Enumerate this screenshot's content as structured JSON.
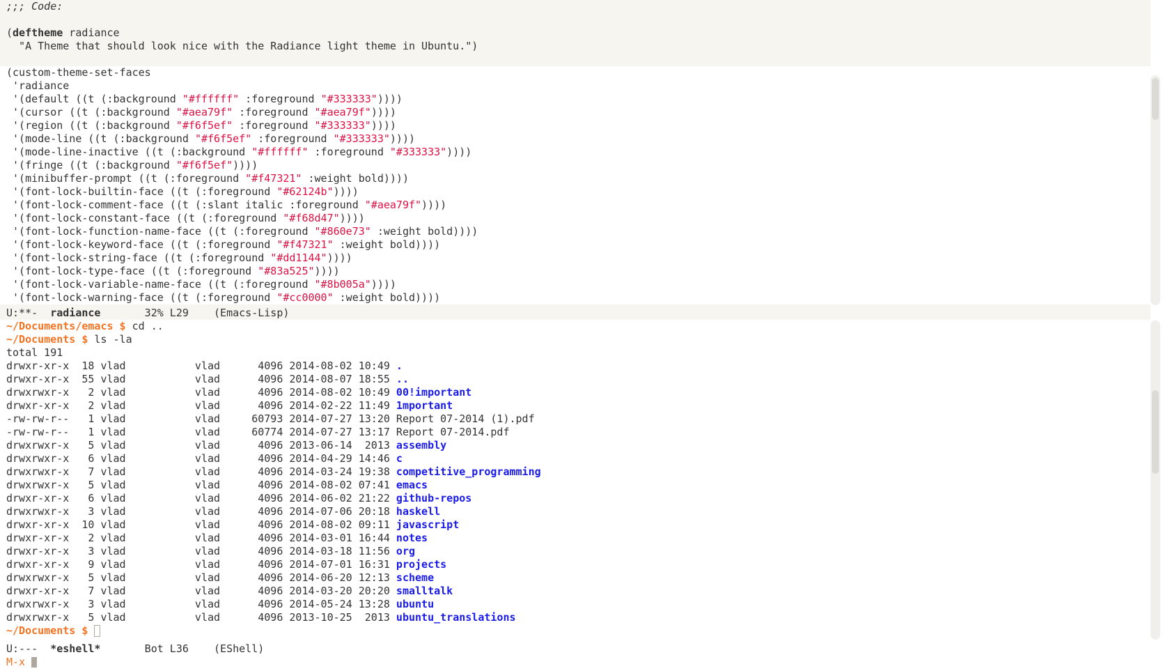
{
  "code": {
    "header_comment": ";;; Code:",
    "deftheme_kw": "deftheme",
    "deftheme_name": " radiance",
    "docstring": "  \"A Theme that should look nice with the Radiance light theme in Ubuntu.\")",
    "custom_open": "(custom-theme-set-faces",
    "radiance_sym": " 'radiance",
    "faces": [
      {
        "pre": " '(default ((t (:background ",
        "s1": "\"#ffffff\"",
        "mid": " :foreground ",
        "s2": "\"#333333\"",
        "post": "))))"
      },
      {
        "pre": " '(cursor ((t (:background ",
        "s1": "\"#aea79f\"",
        "mid": " :foreground ",
        "s2": "\"#aea79f\"",
        "post": "))))"
      },
      {
        "pre": " '(region ((t (:background ",
        "s1": "\"#f6f5ef\"",
        "mid": " :foreground ",
        "s2": "\"#333333\"",
        "post": "))))"
      },
      {
        "pre": " '(mode-line ((t (:background ",
        "s1": "\"#f6f5ef\"",
        "mid": " :foreground ",
        "s2": "\"#333333\"",
        "post": "))))"
      },
      {
        "pre": " '(mode-line-inactive ((t (:background ",
        "s1": "\"#ffffff\"",
        "mid": " :foreground ",
        "s2": "\"#333333\"",
        "post": "))))"
      },
      {
        "pre": " '(fringe ((t (:background ",
        "s1": "\"#f6f5ef\"",
        "mid": "",
        "s2": "",
        "post": "))))"
      },
      {
        "pre": " '(minibuffer-prompt ((t (:foreground ",
        "s1": "\"#f47321\"",
        "mid": " :weight bold",
        "s2": "",
        "post": "))))"
      },
      {
        "pre": " '(font-lock-builtin-face ((t (:foreground ",
        "s1": "\"#62124b\"",
        "mid": "",
        "s2": "",
        "post": "))))"
      },
      {
        "pre": " '(font-lock-comment-face ((t (:slant italic :foreground ",
        "s1": "\"#aea79f\"",
        "mid": "",
        "s2": "",
        "post": "))))"
      },
      {
        "pre": " '(font-lock-constant-face ((t (:foreground ",
        "s1": "\"#f68d47\"",
        "mid": "",
        "s2": "",
        "post": "))))"
      },
      {
        "pre": " '(font-lock-function-name-face ((t (:foreground ",
        "s1": "\"#860e73\"",
        "mid": " :weight bold",
        "s2": "",
        "post": "))))"
      },
      {
        "pre": " '(font-lock-keyword-face ((t (:foreground ",
        "s1": "\"#f47321\"",
        "mid": " :weight bold",
        "s2": "",
        "post": "))))"
      },
      {
        "pre": " '(font-lock-string-face ((t (:foreground ",
        "s1": "\"#dd1144\"",
        "mid": "",
        "s2": "",
        "post": "))))"
      },
      {
        "pre": " '(font-lock-type-face ((t (:foreground ",
        "s1": "\"#83a525\"",
        "mid": "",
        "s2": "",
        "post": "))))"
      },
      {
        "pre": " '(font-lock-variable-name-face ((t (:foreground ",
        "s1": "\"#8b005a\"",
        "mid": "",
        "s2": "",
        "post": "))))"
      },
      {
        "pre": " '(font-lock-warning-face ((t (:foreground ",
        "s1": "\"#cc0000\"",
        "mid": " :weight bold",
        "s2": "",
        "post": "))))"
      }
    ]
  },
  "modeline_top": {
    "status": "U:**-  ",
    "buffer": "radiance",
    "position": "       32% L29    (Emacs-Lisp)"
  },
  "shell": {
    "cmd1_prompt": "~/Documents/emacs $",
    "cmd1": " cd ..",
    "cmd2_prompt": "~/Documents $",
    "cmd2": " ls -la",
    "total": "total 191",
    "entries": [
      {
        "meta": "drwxr-xr-x  18 vlad           vlad      4096 2014-08-02 10:49 ",
        "name": ".",
        "dir": true
      },
      {
        "meta": "drwxr-xr-x  55 vlad           vlad      4096 2014-08-07 18:55 ",
        "name": "..",
        "dir": true
      },
      {
        "meta": "drwxrwxr-x   2 vlad           vlad      4096 2014-08-02 10:49 ",
        "name": "00!important",
        "dir": true
      },
      {
        "meta": "drwxr-xr-x   2 vlad           vlad      4096 2014-02-22 11:49 ",
        "name": "1mportant",
        "dir": true
      },
      {
        "meta": "-rw-rw-r--   1 vlad           vlad     60793 2014-07-27 13:20 ",
        "name": "Report 07-2014 (1).pdf",
        "dir": false
      },
      {
        "meta": "-rw-rw-r--   1 vlad           vlad     60774 2014-07-27 13:17 ",
        "name": "Report 07-2014.pdf",
        "dir": false
      },
      {
        "meta": "drwxrwxr-x   5 vlad           vlad      4096 2013-06-14  2013 ",
        "name": "assembly",
        "dir": true
      },
      {
        "meta": "drwxrwxr-x   6 vlad           vlad      4096 2014-04-29 14:46 ",
        "name": "c",
        "dir": true
      },
      {
        "meta": "drwxrwxr-x   7 vlad           vlad      4096 2014-03-24 19:38 ",
        "name": "competitive_programming",
        "dir": true
      },
      {
        "meta": "drwxrwxr-x   5 vlad           vlad      4096 2014-08-02 07:41 ",
        "name": "emacs",
        "dir": true
      },
      {
        "meta": "drwxr-xr-x   6 vlad           vlad      4096 2014-06-02 21:22 ",
        "name": "github-repos",
        "dir": true
      },
      {
        "meta": "drwxrwxr-x   3 vlad           vlad      4096 2014-07-06 20:18 ",
        "name": "haskell",
        "dir": true
      },
      {
        "meta": "drwxr-xr-x  10 vlad           vlad      4096 2014-08-02 09:11 ",
        "name": "javascript",
        "dir": true
      },
      {
        "meta": "drwxr-xr-x   2 vlad           vlad      4096 2014-03-01 16:44 ",
        "name": "notes",
        "dir": true
      },
      {
        "meta": "drwxr-xr-x   3 vlad           vlad      4096 2014-03-18 11:56 ",
        "name": "org",
        "dir": true
      },
      {
        "meta": "drwxr-xr-x   9 vlad           vlad      4096 2014-07-01 16:31 ",
        "name": "projects",
        "dir": true
      },
      {
        "meta": "drwxrwxr-x   5 vlad           vlad      4096 2014-06-20 12:13 ",
        "name": "scheme",
        "dir": true
      },
      {
        "meta": "drwxr-xr-x   7 vlad           vlad      4096 2014-03-20 20:20 ",
        "name": "smalltalk",
        "dir": true
      },
      {
        "meta": "drwxrwxr-x   3 vlad           vlad      4096 2014-05-24 13:28 ",
        "name": "ubuntu",
        "dir": true
      },
      {
        "meta": "drwxrwxr-x   5 vlad           vlad      4096 2013-10-25  2013 ",
        "name": "ubuntu_translations",
        "dir": true
      }
    ],
    "final_prompt": "~/Documents $"
  },
  "modeline_bottom": {
    "status": "U:---  ",
    "buffer": "*eshell*",
    "position": "       Bot L36    (EShell)"
  },
  "minibuffer": {
    "prompt": "M-x "
  },
  "colors": {
    "fringe": "#f6f5ef",
    "keyword": "#f47321",
    "string": "#dd1144",
    "directory": "#1a1ae6",
    "cursor": "#aea79f"
  }
}
